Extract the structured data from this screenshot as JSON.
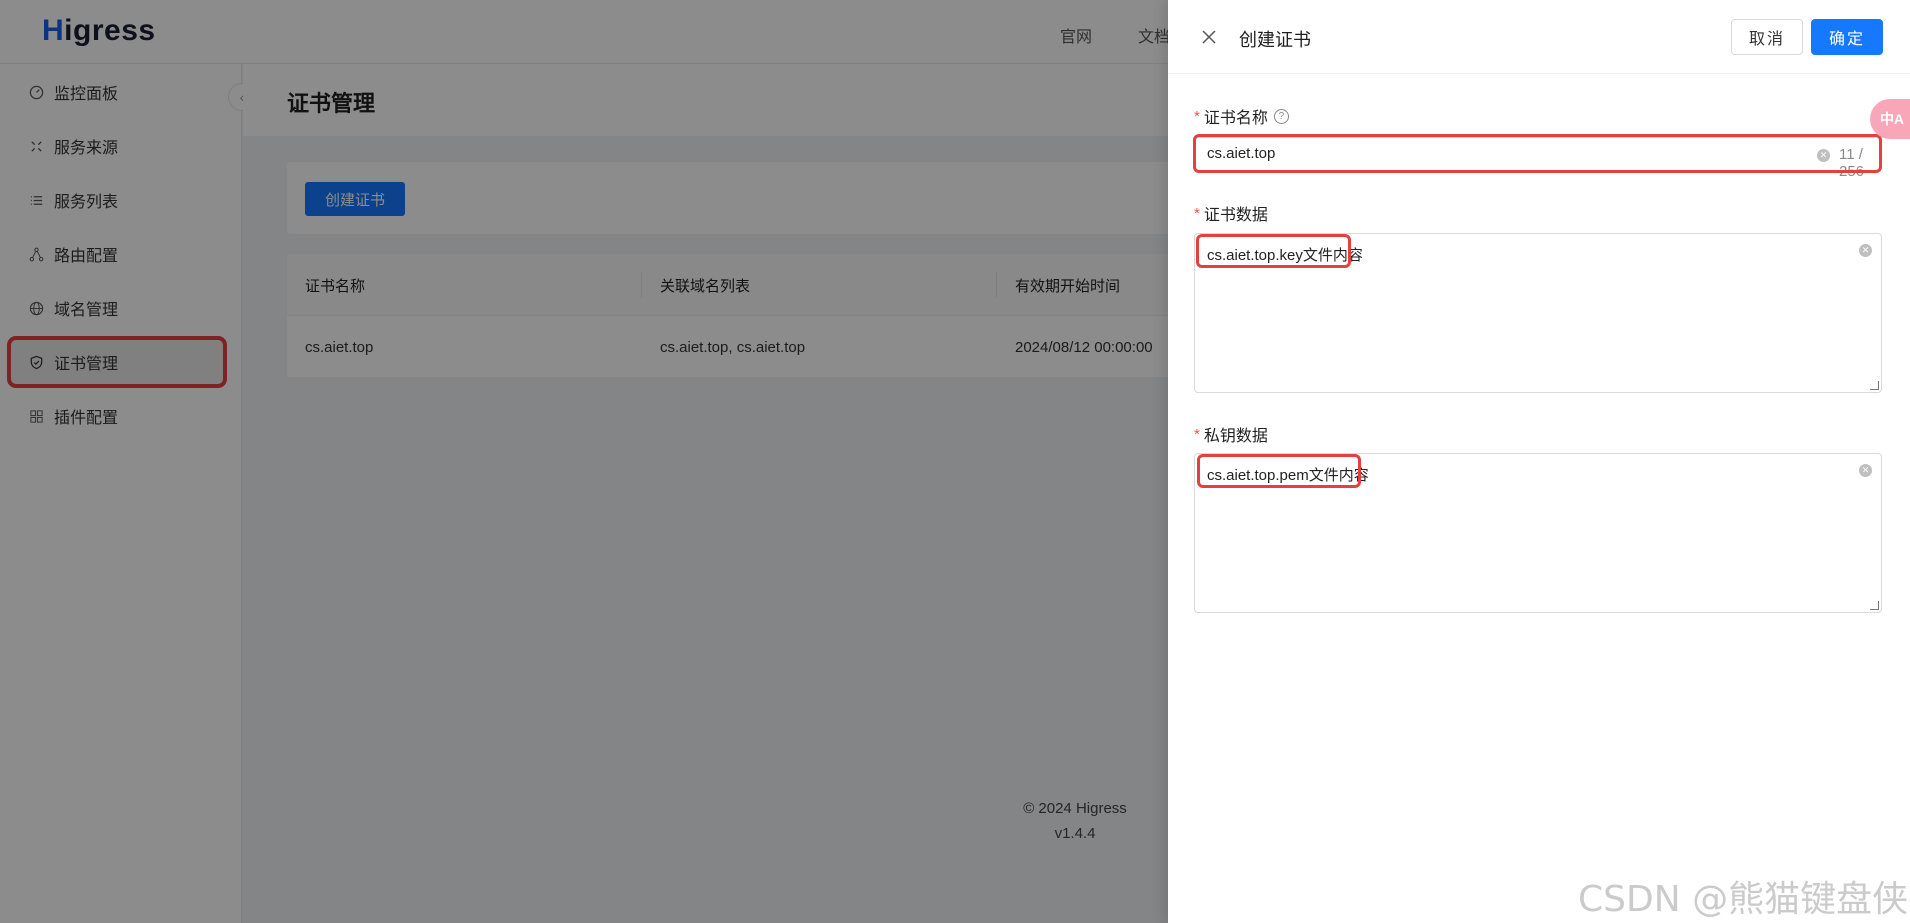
{
  "app": {
    "logo": "Higress",
    "topnav": [
      "官网",
      "文档"
    ],
    "sidebar": [
      {
        "label": "监控面板",
        "icon": "dashboard-icon"
      },
      {
        "label": "服务来源",
        "icon": "source-icon"
      },
      {
        "label": "服务列表",
        "icon": "list-icon"
      },
      {
        "label": "路由配置",
        "icon": "route-icon"
      },
      {
        "label": "域名管理",
        "icon": "globe-icon"
      },
      {
        "label": "证书管理",
        "icon": "shield-icon",
        "active": true
      },
      {
        "label": "插件配置",
        "icon": "plugin-icon"
      }
    ],
    "page_title": "证书管理",
    "create_button": "创建证书",
    "table": {
      "columns": [
        "证书名称",
        "关联域名列表",
        "有效期开始时间"
      ],
      "rows": [
        [
          "cs.aiet.top",
          "cs.aiet.top, cs.aiet.top",
          "2024/08/12 00:00:00"
        ]
      ]
    },
    "footer": {
      "copyright": "© 2024 Higress",
      "version": "v1.4.4"
    }
  },
  "drawer": {
    "title": "创建证书",
    "cancel_label": "取消",
    "ok_label": "确定",
    "fields": {
      "name": {
        "label": "证书名称",
        "value": "cs.aiet.top",
        "count": "11 / 256"
      },
      "cert": {
        "label": "证书数据",
        "value": "cs.aiet.top.key文件内容"
      },
      "key": {
        "label": "私钥数据",
        "value": "cs.aiet.top.pem文件内容"
      }
    }
  },
  "overlay": {
    "translate": "中A",
    "watermark": "CSDN @熊猫键盘侠"
  }
}
